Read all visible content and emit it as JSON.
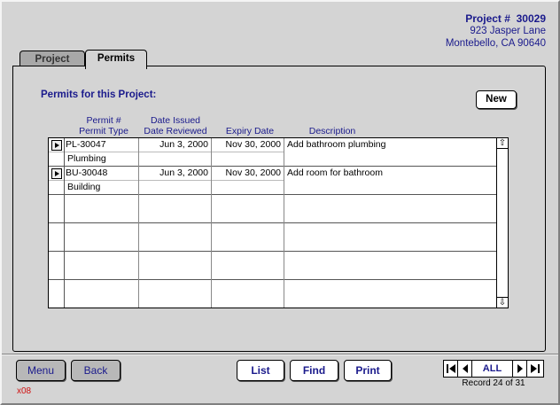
{
  "project": {
    "label": "Project #",
    "number": "30029",
    "address_line1": "923 Jasper Lane",
    "address_line2": "Montebello, CA 90640"
  },
  "tabs": [
    {
      "label": "Project",
      "active": false
    },
    {
      "label": "Permits",
      "active": true
    }
  ],
  "section_title": "Permits for this Project:",
  "new_button": "New",
  "columns": {
    "permit_num": "Permit #",
    "permit_type": "Permit Type",
    "date_issued": "Date Issued",
    "date_reviewed": "Date Reviewed",
    "expiry": "Expiry Date",
    "description": "Description"
  },
  "permits": [
    {
      "number": "PL-30047",
      "type": "Plumbing",
      "date_issued": "Jun 3, 2000",
      "date_reviewed": "",
      "expiry": "Nov 30, 2000",
      "description": "Add bathroom plumbing"
    },
    {
      "number": "BU-30048",
      "type": "Building",
      "date_issued": "Jun 3, 2000",
      "date_reviewed": "",
      "expiry": "Nov 30, 2000",
      "description": "Add room for bathroom"
    }
  ],
  "footer": {
    "menu": "Menu",
    "back": "Back",
    "list": "List",
    "find": "Find",
    "print": "Print",
    "all": "ALL",
    "record_status": "Record 24 of 31",
    "code": "x08"
  },
  "icons": {
    "first": "first-record-icon",
    "prev": "previous-record-icon",
    "next": "next-record-icon",
    "last": "last-record-icon",
    "scroll_up": "scroll-up-icon",
    "scroll_down": "scroll-down-icon",
    "row_select": "row-selector-icon"
  },
  "colors": {
    "accent_text": "#1a1a8c",
    "code_text": "#d01010"
  }
}
